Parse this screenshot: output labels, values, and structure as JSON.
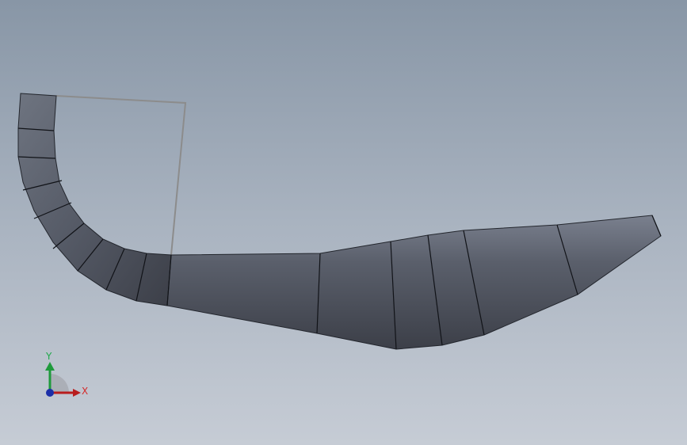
{
  "viewport": {
    "background_top": "#8896a6",
    "background_bottom": "#c6ccd5"
  },
  "model": {
    "body_color": "#4a4e59",
    "highlight_color": "#7a808e",
    "edge_color": "#111318",
    "sketch_color": "#8c8c8c"
  },
  "triad": {
    "x_label": "X",
    "y_label": "Y",
    "x_color": "#b81d1d",
    "y_color": "#1f9a3c",
    "z_color": "#1c2fa8"
  }
}
